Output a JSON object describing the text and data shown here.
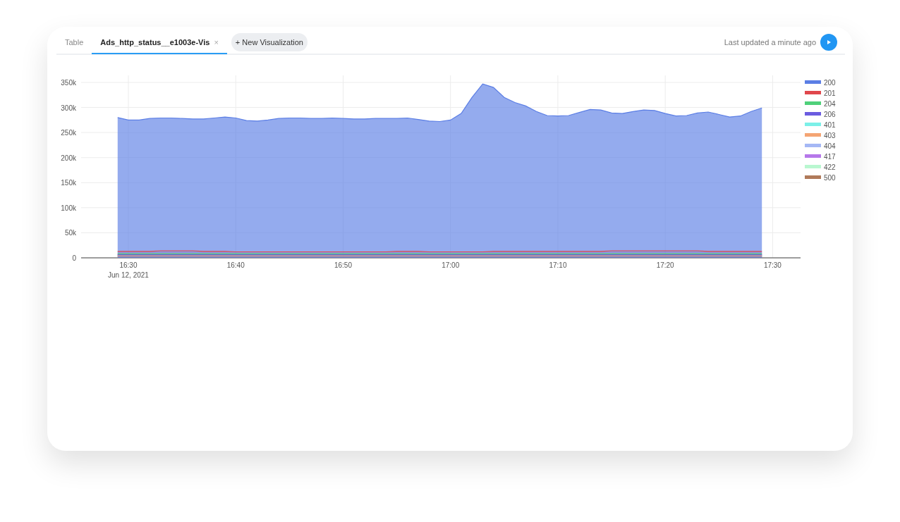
{
  "tabs": [
    {
      "label": "Table",
      "selected": false
    },
    {
      "label": "Ads_http_status__e1003e-Vis",
      "selected": true,
      "close": "×"
    }
  ],
  "new_tab_button": "+ New Visualization",
  "last_updated": "Last updated a minute ago",
  "chart_data": {
    "type": "area",
    "stacked": false,
    "grid": true,
    "legend": true,
    "categories": [
      null,
      "16:30",
      null,
      null,
      null,
      null,
      null,
      null,
      null,
      null,
      null,
      "16:40",
      null,
      null,
      null,
      null,
      null,
      null,
      null,
      null,
      null,
      "16:50",
      null,
      null,
      null,
      null,
      null,
      null,
      null,
      null,
      null,
      "17:00",
      null,
      null,
      null,
      null,
      null,
      null,
      null,
      null,
      null,
      "17:10",
      null,
      null,
      null,
      null,
      null,
      null,
      null,
      null,
      null,
      "17:20",
      null,
      null,
      null,
      null,
      null,
      null,
      null,
      null,
      null,
      "17:30"
    ],
    "yticks": [
      {
        "value": 0,
        "label": "0"
      },
      {
        "value": 50000,
        "label": "50k"
      },
      {
        "value": 100000,
        "label": "100k"
      },
      {
        "value": 150000,
        "label": "150k"
      },
      {
        "value": 200000,
        "label": "200k"
      },
      {
        "value": 250000,
        "label": "250k"
      },
      {
        "value": 300000,
        "label": "300k"
      },
      {
        "value": 350000,
        "label": "350k"
      }
    ],
    "ylim": [
      0,
      350000
    ],
    "annotations": [
      "Jun 12, 2021"
    ],
    "series": [
      {
        "name": "200",
        "color": "#5b7ee5",
        "values": [
          280000,
          275000,
          275000,
          278000,
          279000,
          279000,
          278000,
          277000,
          277000,
          279000,
          281000,
          279000,
          274000,
          273000,
          275000,
          278000,
          279000,
          279000,
          278000,
          278000,
          279000,
          278000,
          277000,
          277000,
          278000,
          278000,
          278000,
          279000,
          276000,
          273000,
          272000,
          275000,
          288000,
          320000,
          347000,
          340000,
          320000,
          310000,
          303000,
          292000,
          284000,
          283000,
          284000,
          290000,
          296000,
          295000,
          289000,
          288000,
          292000,
          295000,
          294000,
          288000,
          283000,
          284000,
          289000,
          291000,
          286000,
          281000,
          283000,
          292000,
          299000,
          null
        ]
      },
      {
        "name": "201",
        "color": "#e0474c",
        "values": [
          13000,
          13000,
          13000,
          13000,
          14000,
          14000,
          14000,
          14000,
          13000,
          13000,
          13000,
          12000,
          12000,
          12000,
          12000,
          12000,
          12000,
          12000,
          12000,
          12000,
          12000,
          12000,
          12000,
          12000,
          12000,
          12000,
          13000,
          13000,
          13000,
          12000,
          12000,
          12000,
          12000,
          12000,
          12000,
          13000,
          13000,
          13000,
          13000,
          13000,
          13000,
          13000,
          13000,
          13000,
          13000,
          13000,
          14000,
          14000,
          14000,
          14000,
          14000,
          14000,
          14000,
          14000,
          14000,
          13000,
          13000,
          13000,
          13000,
          13000,
          13000,
          null
        ]
      },
      {
        "name": "204",
        "color": "#4fd07a",
        "values": [
          8000,
          8000,
          8000,
          8000,
          8000,
          8000,
          8000,
          8000,
          8000,
          8000,
          8000,
          8000,
          8000,
          8000,
          8000,
          8000,
          8000,
          8000,
          8000,
          8000,
          8000,
          8000,
          8000,
          8000,
          8000,
          8000,
          8000,
          8000,
          8000,
          8000,
          8000,
          8000,
          8000,
          8000,
          8000,
          8000,
          8000,
          8000,
          8000,
          8000,
          8000,
          8000,
          8000,
          8000,
          8000,
          8000,
          8000,
          8000,
          8000,
          8000,
          8000,
          8000,
          8000,
          8000,
          8000,
          8000,
          8000,
          8000,
          8000,
          8000,
          8000,
          null
        ]
      },
      {
        "name": "206",
        "color": "#6b5ce0",
        "values": [
          6000,
          6000,
          6000,
          6000,
          6000,
          6000,
          6000,
          6000,
          6000,
          6000,
          6000,
          6000,
          6000,
          6000,
          6000,
          6000,
          6000,
          6000,
          6000,
          6000,
          6000,
          6000,
          6000,
          6000,
          6000,
          6000,
          6000,
          6000,
          6000,
          6000,
          6000,
          6000,
          6000,
          6000,
          6000,
          6000,
          6000,
          6000,
          6000,
          6000,
          6000,
          6000,
          6000,
          6000,
          6000,
          6000,
          6000,
          6000,
          6000,
          6000,
          6000,
          6000,
          6000,
          6000,
          6000,
          6000,
          6000,
          6000,
          6000,
          6000,
          6000,
          null
        ]
      },
      {
        "name": "401",
        "color": "#7cf0e8",
        "values": [
          null,
          null,
          null,
          null,
          null,
          null,
          null,
          null,
          null,
          null,
          null,
          null,
          null,
          null,
          null,
          null,
          null,
          null,
          null,
          null,
          null,
          null,
          null,
          null,
          null,
          null,
          null,
          null,
          null,
          null,
          null,
          null,
          null,
          null,
          null,
          null,
          null,
          null,
          null,
          null,
          null,
          null,
          null,
          null,
          null,
          null,
          null,
          null,
          null,
          null,
          null,
          null,
          null,
          null,
          null,
          null,
          null,
          null,
          null,
          null,
          null,
          null
        ]
      },
      {
        "name": "403",
        "color": "#f4a574",
        "values": [
          4000,
          4000,
          4000,
          4000,
          4000,
          4000,
          4000,
          4000,
          4000,
          4000,
          4000,
          4000,
          4000,
          4000,
          4000,
          4000,
          4000,
          4000,
          4000,
          4000,
          4000,
          4000,
          4000,
          4000,
          4000,
          4000,
          4000,
          4000,
          4000,
          4000,
          4000,
          4000,
          4000,
          4000,
          4000,
          4000,
          4000,
          4000,
          4000,
          4000,
          4000,
          4000,
          4000,
          4000,
          4000,
          4000,
          4000,
          4000,
          4000,
          4000,
          4000,
          4000,
          4000,
          4000,
          4000,
          4000,
          4000,
          4000,
          4000,
          4000,
          4000,
          null
        ]
      },
      {
        "name": "404",
        "color": "#a5b8f5",
        "values": [
          null,
          null,
          null,
          null,
          null,
          null,
          null,
          null,
          null,
          null,
          null,
          null,
          null,
          null,
          null,
          null,
          null,
          null,
          null,
          null,
          null,
          null,
          null,
          null,
          null,
          null,
          null,
          null,
          null,
          null,
          null,
          null,
          null,
          null,
          null,
          null,
          null,
          null,
          null,
          null,
          null,
          null,
          null,
          null,
          null,
          null,
          null,
          null,
          null,
          null,
          null,
          null,
          null,
          null,
          null,
          null,
          null,
          null,
          null,
          null,
          null,
          null
        ]
      },
      {
        "name": "417",
        "color": "#b678ea",
        "values": [
          null,
          null,
          null,
          null,
          null,
          null,
          null,
          null,
          null,
          null,
          null,
          null,
          null,
          null,
          null,
          null,
          null,
          null,
          null,
          null,
          null,
          null,
          null,
          null,
          null,
          null,
          null,
          null,
          null,
          null,
          null,
          null,
          null,
          null,
          null,
          null,
          null,
          null,
          null,
          null,
          null,
          null,
          null,
          null,
          null,
          null,
          null,
          null,
          null,
          null,
          null,
          null,
          null,
          null,
          null,
          null,
          null,
          null,
          null,
          null,
          null,
          null
        ]
      },
      {
        "name": "422",
        "color": "#b9f7d0",
        "values": [
          null,
          null,
          null,
          null,
          null,
          null,
          null,
          null,
          null,
          null,
          null,
          null,
          null,
          null,
          null,
          null,
          null,
          null,
          null,
          null,
          null,
          null,
          null,
          null,
          null,
          null,
          null,
          null,
          null,
          null,
          null,
          null,
          null,
          null,
          null,
          null,
          null,
          null,
          null,
          null,
          null,
          null,
          null,
          null,
          null,
          null,
          null,
          null,
          null,
          null,
          null,
          null,
          null,
          null,
          null,
          null,
          null,
          null,
          null,
          null,
          null,
          null
        ]
      },
      {
        "name": "500",
        "color": "#b07a5a",
        "values": [
          null,
          null,
          null,
          null,
          null,
          null,
          null,
          null,
          null,
          null,
          null,
          null,
          null,
          null,
          null,
          null,
          null,
          null,
          null,
          null,
          null,
          null,
          null,
          null,
          null,
          null,
          null,
          null,
          null,
          null,
          null,
          null,
          null,
          null,
          null,
          null,
          null,
          null,
          null,
          null,
          null,
          null,
          null,
          null,
          null,
          null,
          null,
          null,
          null,
          null,
          null,
          null,
          null,
          null,
          null,
          null,
          null,
          null,
          null,
          null,
          null,
          null
        ]
      }
    ]
  }
}
